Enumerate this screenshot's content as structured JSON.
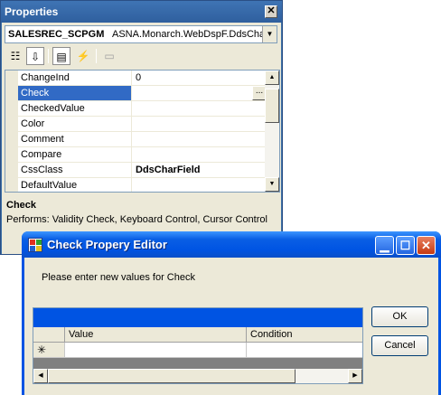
{
  "properties_window": {
    "title": "Properties",
    "close_glyph": "✕",
    "object_selector": {
      "name": "SALESREC_SCPGM",
      "type": "ASNA.Monarch.WebDspF.DdsChar",
      "dropdown_glyph": "▼"
    },
    "toolbar": [
      {
        "icon": "categorized-icon",
        "glyph": "☷"
      },
      {
        "icon": "alphabetical-icon",
        "glyph": "⇩"
      },
      {
        "icon": "properties-icon",
        "glyph": "▤"
      },
      {
        "icon": "events-icon",
        "glyph": "⚡"
      },
      {
        "icon": "property-pages-icon",
        "glyph": "▭"
      }
    ],
    "rows": [
      {
        "name": "ChangeInd",
        "value": "0"
      },
      {
        "name": "Check",
        "value": "",
        "selected": true,
        "ellipsis": "..."
      },
      {
        "name": "CheckedValue",
        "value": ""
      },
      {
        "name": "Color",
        "value": ""
      },
      {
        "name": "Comment",
        "value": ""
      },
      {
        "name": "Compare",
        "value": ""
      },
      {
        "name": "CssClass",
        "value": "DdsCharField",
        "bold": true
      },
      {
        "name": "DefaultValue",
        "value": ""
      }
    ],
    "scroll_up": "▲",
    "scroll_down": "▼",
    "description": {
      "title": "Check",
      "text": "Performs: Validity Check, Keyboard Control, Cursor Control"
    }
  },
  "dialog": {
    "title": "Check Propery Editor",
    "minimize_glyph": "▁",
    "maximize_glyph": "☐",
    "close_glyph": "✕",
    "prompt": "Please enter new values for Check",
    "ok_label": "OK",
    "cancel_label": "Cancel",
    "grid": {
      "columns": [
        "Value",
        "Condition"
      ],
      "new_row_marker": "✳",
      "scroll_left": "◀",
      "scroll_right": "▶"
    }
  },
  "colors": {
    "selection": "#316ac5",
    "xp_title_blue": "#0054e3",
    "dialog_face": "#ece9d8"
  }
}
